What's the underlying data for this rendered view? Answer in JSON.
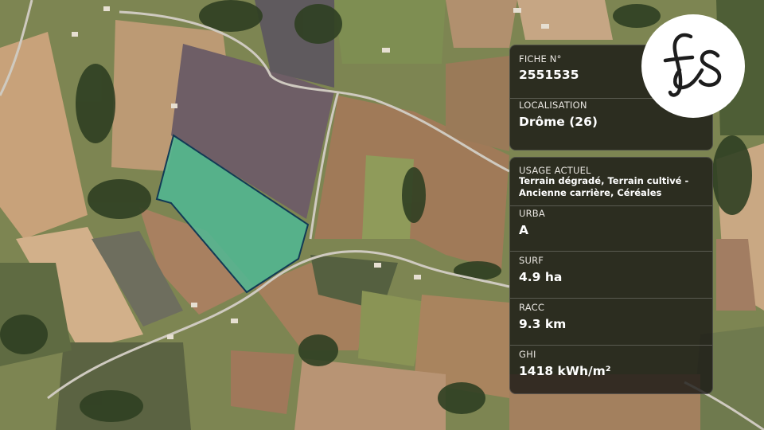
{
  "fiche": {
    "label": "FICHE N°",
    "value": "2551535"
  },
  "localisation": {
    "label": "LOCALISATION",
    "value": "Drôme (26)"
  },
  "usage": {
    "label": "USAGE ACTUEL",
    "value": "Terrain dégradé, Terrain cultivé - Ancienne carrière, Céréales"
  },
  "urba": {
    "label": "URBA",
    "value": "A"
  },
  "surf": {
    "label": "SURF",
    "value": "4.9 ha"
  },
  "racc": {
    "label": "RACC",
    "value": "9.3 km"
  },
  "ghi": {
    "label": "GHI",
    "value": "1418 kWh/m²"
  },
  "logo": {
    "name": "fs-logo-icon"
  },
  "colors": {
    "parcel_fill": "#4fb894",
    "parcel_stroke": "#123a55",
    "card_bg": "#181614"
  }
}
